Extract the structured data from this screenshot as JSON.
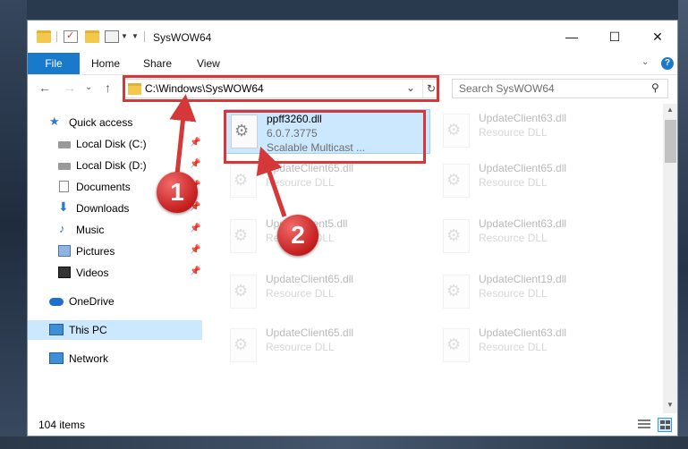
{
  "window": {
    "title": "SysWOW64",
    "minimize_glyph": "—",
    "maximize_glyph": "☐",
    "close_glyph": "✕"
  },
  "ribbon": {
    "file_label": "File",
    "tabs": [
      {
        "label": "Home"
      },
      {
        "label": "Share"
      },
      {
        "label": "View"
      }
    ],
    "help_glyph": "?",
    "expand_glyph": "⌄"
  },
  "navigation": {
    "back_glyph": "←",
    "forward_glyph": "→",
    "recent_glyph": "⌄",
    "up_glyph": "↑",
    "address": "C:\\Windows\\SysWOW64",
    "address_drop_glyph": "⌄",
    "refresh_glyph": "↻",
    "search_placeholder": "Search SysWOW64",
    "search_glyph": "⚲"
  },
  "sidebar": {
    "items": [
      {
        "label": "Quick access",
        "icon": "star-icon",
        "pinned": false
      },
      {
        "label": "Local Disk (C:)",
        "icon": "drive-icon",
        "pinned": true
      },
      {
        "label": "Local Disk (D:)",
        "icon": "drive-icon",
        "pinned": true
      },
      {
        "label": "Documents",
        "icon": "documents-icon",
        "pinned": true
      },
      {
        "label": "Downloads",
        "icon": "download-icon",
        "pinned": true
      },
      {
        "label": "Music",
        "icon": "music-icon",
        "pinned": true
      },
      {
        "label": "Pictures",
        "icon": "pictures-icon",
        "pinned": true
      },
      {
        "label": "Videos",
        "icon": "videos-icon",
        "pinned": true
      },
      {
        "label": "OneDrive",
        "icon": "cloud-icon",
        "pinned": false
      },
      {
        "label": "This PC",
        "icon": "computer-icon",
        "pinned": false,
        "selected": true
      },
      {
        "label": "Network",
        "icon": "network-icon",
        "pinned": false
      }
    ],
    "pin_glyph": "📌"
  },
  "files": [
    {
      "name": "ppff3260.dll",
      "line2": "6.0.7.3775",
      "line3": "Scalable Multicast ...",
      "selected": true
    },
    {
      "name": "UpdateClient63.dll",
      "line2": "Resource DLL"
    },
    {
      "name": "UpdateClient65.dll",
      "line2": "Resource DLL"
    },
    {
      "name": "UpdateClient65.dll",
      "line2": "Resource DLL"
    },
    {
      "name": "UpdateClient5.dll",
      "line2": "Resource DLL"
    },
    {
      "name": "UpdateClient63.dll",
      "line2": "Resource DLL"
    },
    {
      "name": "UpdateClient65.dll",
      "line2": "Resource DLL"
    },
    {
      "name": "UpdateClient19.dll",
      "line2": "Resource DLL"
    },
    {
      "name": "UpdateClient65.dll",
      "line2": "Resource DLL"
    },
    {
      "name": "UpdateClient63.dll",
      "line2": "Resource DLL"
    }
  ],
  "file_icon_glyph": "⚙",
  "scroll": {
    "up_glyph": "▲",
    "down_glyph": "▼"
  },
  "status": {
    "item_count": "104 items"
  },
  "annotations": {
    "badge1": "1",
    "badge2": "2",
    "color": "#d43838"
  },
  "colors": {
    "accent": "#1979ca",
    "selection": "#cce8ff"
  }
}
